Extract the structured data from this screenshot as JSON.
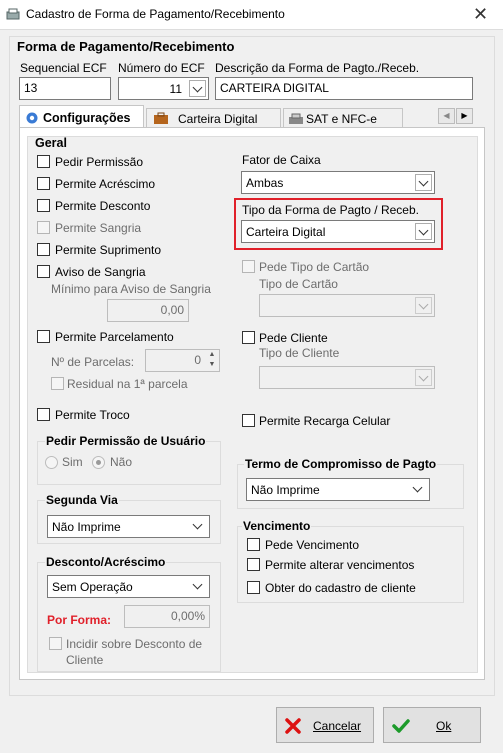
{
  "window": {
    "title": "Cadastro de Forma de Pagamento/Recebimento",
    "close_glyph": "✕"
  },
  "header": {
    "section_title": "Forma de Pagamento/Recebimento",
    "seq_label": "Sequencial ECF",
    "seq_value": "13",
    "ecf_label": "Número do ECF",
    "ecf_value": "11",
    "desc_label": "Descrição da Forma de Pagto./Receb.",
    "desc_value": "CARTEIRA DIGITAL"
  },
  "tabs": [
    {
      "label": "Configurações",
      "icon": "gear-icon",
      "active": true
    },
    {
      "label": "Carteira Digital",
      "icon": "wallet-icon"
    },
    {
      "label": "SAT e NFC-e",
      "icon": "printer-icon"
    }
  ],
  "geral": {
    "title": "Geral",
    "checks": [
      {
        "label": "Pedir Permissão"
      },
      {
        "label": "Permite Acréscimo"
      },
      {
        "label": "Permite Desconto"
      },
      {
        "label": "Permite Sangria",
        "disabled": true
      },
      {
        "label": "Permite Suprimento"
      },
      {
        "label": "Aviso de Sangria"
      },
      {
        "label": "Permite Parcelamento"
      },
      {
        "label": "Residual na 1ª parcela",
        "disabled": true
      },
      {
        "label": "Permite Troco"
      }
    ],
    "min_sangria_label": "Mínimo para Aviso de Sangria",
    "min_sangria_value": "0,00",
    "parcelas_label": "Nº de Parcelas:",
    "parcelas_value": "0"
  },
  "right": {
    "fator_label": "Fator de Caixa",
    "fator_value": "Ambas",
    "tipo_forma_label": "Tipo da Forma de Pagto / Receb.",
    "tipo_forma_value": "Carteira Digital",
    "highlight_color": "#e0202a",
    "pede_tipo_cartao": "Pede Tipo de Cartão",
    "tipo_cartao_label": "Tipo de Cartão",
    "pede_cliente": "Pede Cliente",
    "tipo_cliente_label": "Tipo de Cliente",
    "recarga": "Permite Recarga Celular"
  },
  "permissao": {
    "title": "Pedir Permissão de Usuário",
    "sim": "Sim",
    "nao": "Não"
  },
  "segunda_via": {
    "title": "Segunda Via",
    "value": "Não Imprime"
  },
  "desconto": {
    "title": "Desconto/Acréscimo",
    "value": "Sem Operação",
    "por_forma": "Por Forma:",
    "por_forma_value": "0,00%",
    "incidir": "Incidir sobre Desconto de Cliente",
    "accent": "#e0202a"
  },
  "termo": {
    "title": "Termo de Compromisso de Pagto",
    "value": "Não Imprime"
  },
  "vencimento": {
    "title": "Vencimento",
    "items": [
      "Pede Vencimento",
      "Permite alterar vencimentos",
      "Obter do cadastro de cliente"
    ]
  },
  "buttons": {
    "cancel": "Cancelar",
    "ok": "Ok"
  }
}
